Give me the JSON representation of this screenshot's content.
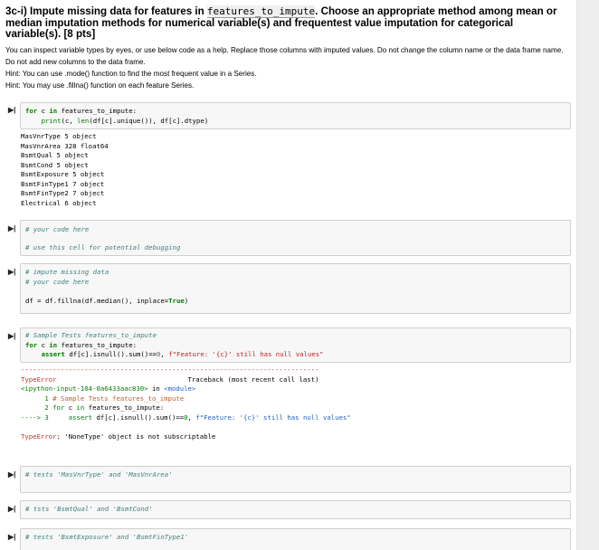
{
  "header": {
    "title_pre": "3c-i) Impute missing data for features in ",
    "title_code": "features_to_impute",
    "title_post": ". Choose an appropriate method among mean or median imputation methods for numerical variable(s) and frequentest value imputation for categorical variable(s). [8 pts]"
  },
  "instructions": {
    "line1": "You can inspect variable types by eyes, or use below code as a help. Replace those columns with imputed values. Do not change the column name or the data frame name. Do not add new columns to the data frame.",
    "hint1": "Hint: You can use .mode() function to find the most frequent value in a Series.",
    "hint2": "Hint: You may use .fillna() function on each feature Series."
  },
  "cells": {
    "c1": {
      "l1": [
        "for",
        " c ",
        "in",
        " features_to_impute:"
      ],
      "l2": [
        "    ",
        "print",
        "(c, ",
        "len",
        "(df[c].unique()), df[c].dtype)"
      ]
    },
    "out1": [
      "MasVnrType 5 object",
      "MasVnrArea 328 float64",
      "BsmtQual 5 object",
      "BsmtCond 5 object",
      "BsmtExposure 5 object",
      "BsmtFinType1 7 object",
      "BsmtFinType2 7 object",
      "Electrical 6 object"
    ],
    "c2": {
      "l1": "# your code here",
      "l2": "# use this cell for potential debugging"
    },
    "c3": {
      "l1": "# impute missing data",
      "l2": "# your code here",
      "l3a": "df = df.fillna(df.median(), inplace=",
      "l3b": "True",
      "l3c": ")"
    },
    "c4": {
      "l1": "# Sample Tests features_to_impute",
      "l2a": "for",
      "l2b": " c ",
      "l2c": "in",
      "l2d": " features_to_impute:",
      "l3a": "    ",
      "l3b": "assert",
      "l3c": " df[c].isnull().sum()==",
      "l3d": "0",
      "l3e": ", ",
      "l3f": "f\"Feature: '{c}' still has null values\""
    },
    "tb": {
      "sep": "---------------------------------------------------------------------------",
      "err": "TypeError",
      "tbtxt": "                                 Traceback (most recent call last)",
      "loc_a": "<ipython-input-104-0a6433aac830>",
      "loc_b": " in ",
      "loc_c": "<module>",
      "n1a": "      1 ",
      "n1b": "# Sample Tests features_to_impute",
      "n2a": "      2 ",
      "n2b": "for",
      "n2c": " c ",
      "n2d": "in",
      "n2e": " features_to_impute:",
      "arrow": "----> 3 ",
      "n3a": "    ",
      "n3b": "assert",
      "n3c": " df[c].isnull().sum()==",
      "n3d": "0",
      "n3e": ", ",
      "n3f": "f\"Feature: '{c}' still has null values\"",
      "final_err": "TypeError",
      "final_msg": ": 'NoneType' object is not subscriptable"
    },
    "c5": "# tests 'MasVnrType' and 'MasVnrArea'",
    "c6": "# tsts 'BsmtQual' and 'BsmtCond'",
    "c7": "# tests 'BsmtExposure' and 'BsmtFinType1'"
  },
  "prompt_icon": "run-cell-icon"
}
